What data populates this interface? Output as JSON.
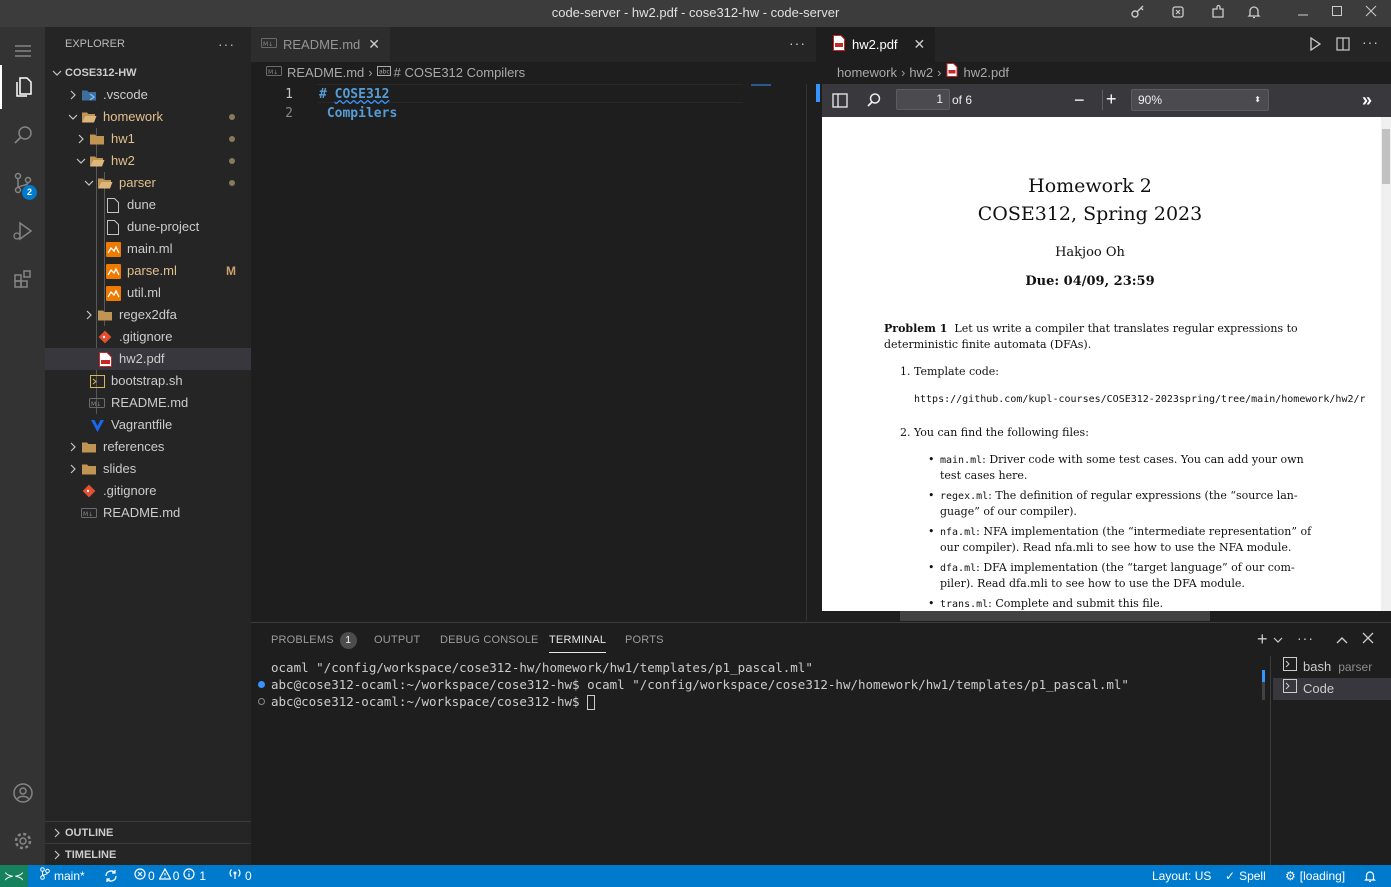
{
  "window": {
    "title": "code-server - hw2.pdf - cose312-hw - code-server"
  },
  "activity_bar": {
    "scm_badge": "2"
  },
  "explorer": {
    "header": "EXPLORER",
    "more": "···",
    "root": "COSE312-HW",
    "items": [
      {
        "label": ".vscode",
        "type": "folder",
        "depth": 0,
        "expanded": false
      },
      {
        "label": "homework",
        "type": "folder",
        "depth": 0,
        "expanded": true
      },
      {
        "label": "hw1",
        "type": "folder",
        "depth": 1,
        "expanded": false
      },
      {
        "label": "hw2",
        "type": "folder",
        "depth": 1,
        "expanded": true
      },
      {
        "label": "parser",
        "type": "folder",
        "depth": 2,
        "expanded": true
      },
      {
        "label": "dune",
        "type": "file",
        "depth": 3
      },
      {
        "label": "dune-project",
        "type": "file",
        "depth": 3
      },
      {
        "label": "main.ml",
        "type": "ml",
        "depth": 3
      },
      {
        "label": "parse.ml",
        "type": "ml",
        "depth": 3,
        "status": "M"
      },
      {
        "label": "util.ml",
        "type": "ml",
        "depth": 3
      },
      {
        "label": "regex2dfa",
        "type": "folder",
        "depth": 2,
        "expanded": false
      },
      {
        "label": ".gitignore",
        "type": "git",
        "depth": 2
      },
      {
        "label": "hw2.pdf",
        "type": "pdf",
        "depth": 2
      },
      {
        "label": "bootstrap.sh",
        "type": "sh",
        "depth": 1
      },
      {
        "label": "README.md",
        "type": "md",
        "depth": 1
      },
      {
        "label": "Vagrantfile",
        "type": "vagrant",
        "depth": 1
      },
      {
        "label": "references",
        "type": "folder",
        "depth": 0,
        "expanded": false
      },
      {
        "label": "slides",
        "type": "folder",
        "depth": 0,
        "expanded": false
      },
      {
        "label": ".gitignore",
        "type": "git",
        "depth": 0
      },
      {
        "label": "README.md",
        "type": "md",
        "depth": 0
      }
    ],
    "outline": "OUTLINE",
    "timeline": "TIMELINE"
  },
  "editor1": {
    "tab_label": "README.md",
    "more": "···",
    "breadcrumb_file": "README.md",
    "breadcrumb_symbol": "# COSE312 Compilers",
    "lines": [
      {
        "num": "1",
        "hash": "# ",
        "text": "COSE312",
        "rest": " Compilers"
      },
      {
        "num": "2",
        "hash": "",
        "text": "",
        "rest": ""
      }
    ]
  },
  "editor2": {
    "tab_label": "hw2.pdf",
    "breadcrumb": [
      "homework",
      "hw2",
      "hw2.pdf"
    ],
    "page_current": "1",
    "page_total": "of 6",
    "zoom": "90%"
  },
  "pdf": {
    "title1": "Homework 2",
    "title2": "COSE312, Spring 2023",
    "author": "Hakjoo Oh",
    "due": "Due: 04/09, 23:59",
    "problem_label": "Problem 1",
    "problem_line1": "Let us write a compiler that translates regular expressions to",
    "problem_line2": "deterministic finite automata (DFAs).",
    "item1": "1.  Template code:",
    "url": "https://github.com/kupl-courses/COSE312-2023spring/tree/main/homework/hw2/r",
    "item2": "2.  You can find the following files:",
    "bullets": [
      {
        "code": "main.ml",
        "l1": ": Driver code with some test cases. You can add your own",
        "l2": "test cases here."
      },
      {
        "code": "regex.ml",
        "l1": ": The definition of regular expressions (the “source lan-",
        "l2": "guage” of our compiler)."
      },
      {
        "code": "nfa.ml",
        "l1": ": NFA implementation (the “intermediate representation” of",
        "l2": "our compiler). Read nfa.mli to see how to use the NFA module."
      },
      {
        "code": "dfa.ml",
        "l1": ": DFA implementation (the “target language” of our com-",
        "l2": "piler). Read dfa.mli to see how to use the DFA module."
      },
      {
        "code": "trans.ml",
        "l1": ": Complete and submit this file.",
        "l2": ""
      }
    ]
  },
  "panel": {
    "tabs": [
      "PROBLEMS",
      "OUTPUT",
      "DEBUG CONSOLE",
      "TERMINAL",
      "PORTS"
    ],
    "problems_count": "1",
    "terminal_lines": [
      "ocaml \"/config/workspace/cose312-hw/homework/hw1/templates/p1_pascal.ml\"",
      "abc@cose312-ocaml:~/workspace/cose312-hw$ ocaml \"/config/workspace/cose312-hw/homework/hw1/templates/p1_pascal.ml\"",
      "abc@cose312-ocaml:~/workspace/cose312-hw$ "
    ],
    "terminals": [
      {
        "name": "bash",
        "detail": "parser"
      },
      {
        "name": "Code",
        "detail": ""
      }
    ]
  },
  "statusbar": {
    "branch": "main*",
    "errors": "0",
    "warnings": "0",
    "infos": "1",
    "ports": "0",
    "layout": "Layout: US",
    "spell": "Spell",
    "loading": "[loading]"
  }
}
